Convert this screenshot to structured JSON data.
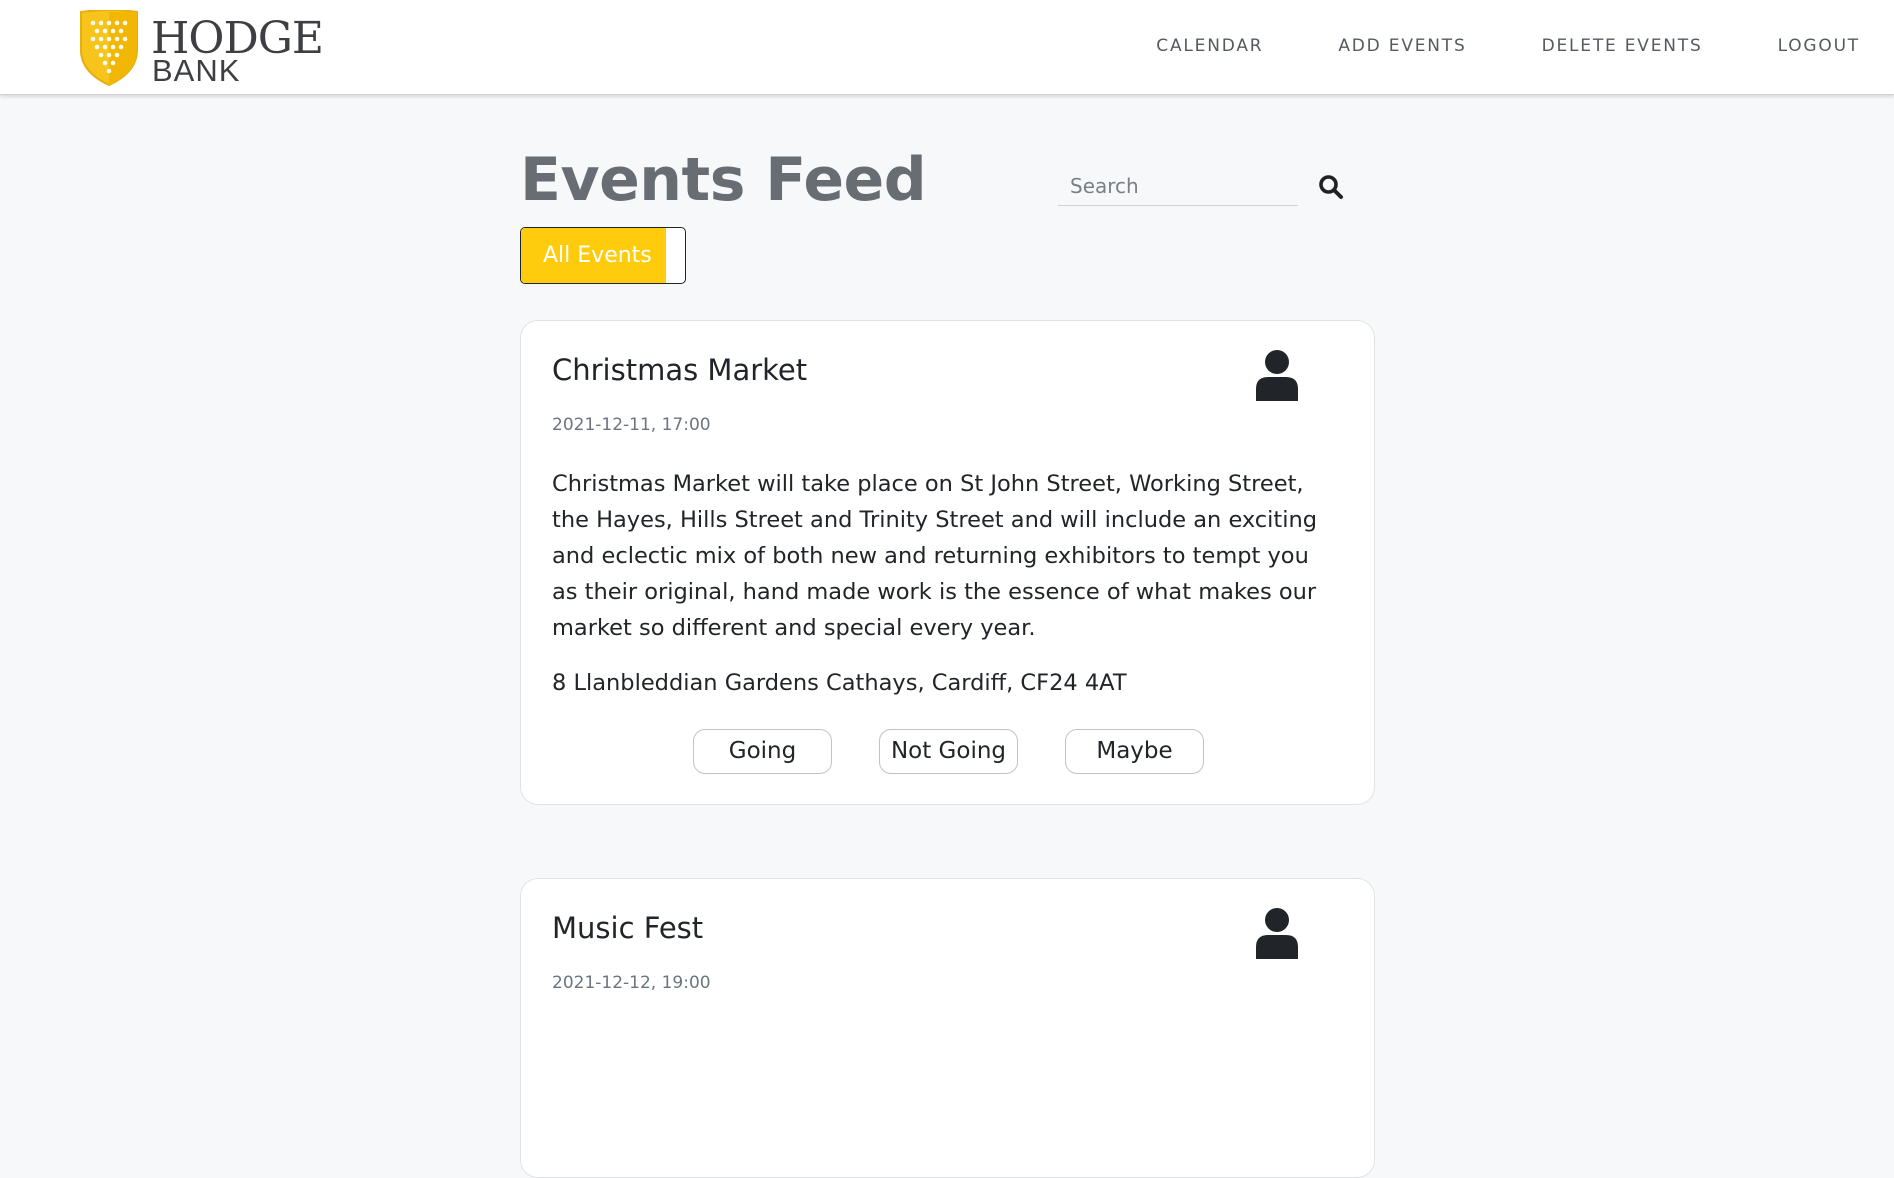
{
  "brand": {
    "name_top": "HODGE",
    "name_bottom": "BANK",
    "accent": "#ffcc0d"
  },
  "nav": {
    "items": [
      {
        "label": "CALENDAR"
      },
      {
        "label": "ADD EVENTS"
      },
      {
        "label": "DELETE EVENTS"
      },
      {
        "label": "LOGOUT"
      }
    ]
  },
  "page": {
    "title": "Events Feed",
    "search": {
      "placeholder": "Search",
      "value": ""
    },
    "filter_toggle": {
      "label": "All Events",
      "state": "on"
    }
  },
  "events": [
    {
      "title": "Christmas Market",
      "datetime": "2021-12-11, 17:00",
      "description": "Christmas Market will take place on St John Street, Working Street, the Hayes, Hills Street and Trinity Street and will include an exciting and eclectic mix of both new and returning exhibitors to tempt you as their original, hand made work is the essence of what makes our market so different and special every year.",
      "address": "8 Llanbleddian Gardens Cathays, Cardiff, CF24 4AT",
      "rsvp": {
        "going": "Going",
        "not_going": "Not Going",
        "maybe": "Maybe"
      }
    },
    {
      "title": "Music Fest",
      "datetime": "2021-12-12, 19:00"
    }
  ],
  "icons": {
    "search": "search-icon",
    "avatar": "user-icon",
    "logo": "shield-logo-icon"
  }
}
